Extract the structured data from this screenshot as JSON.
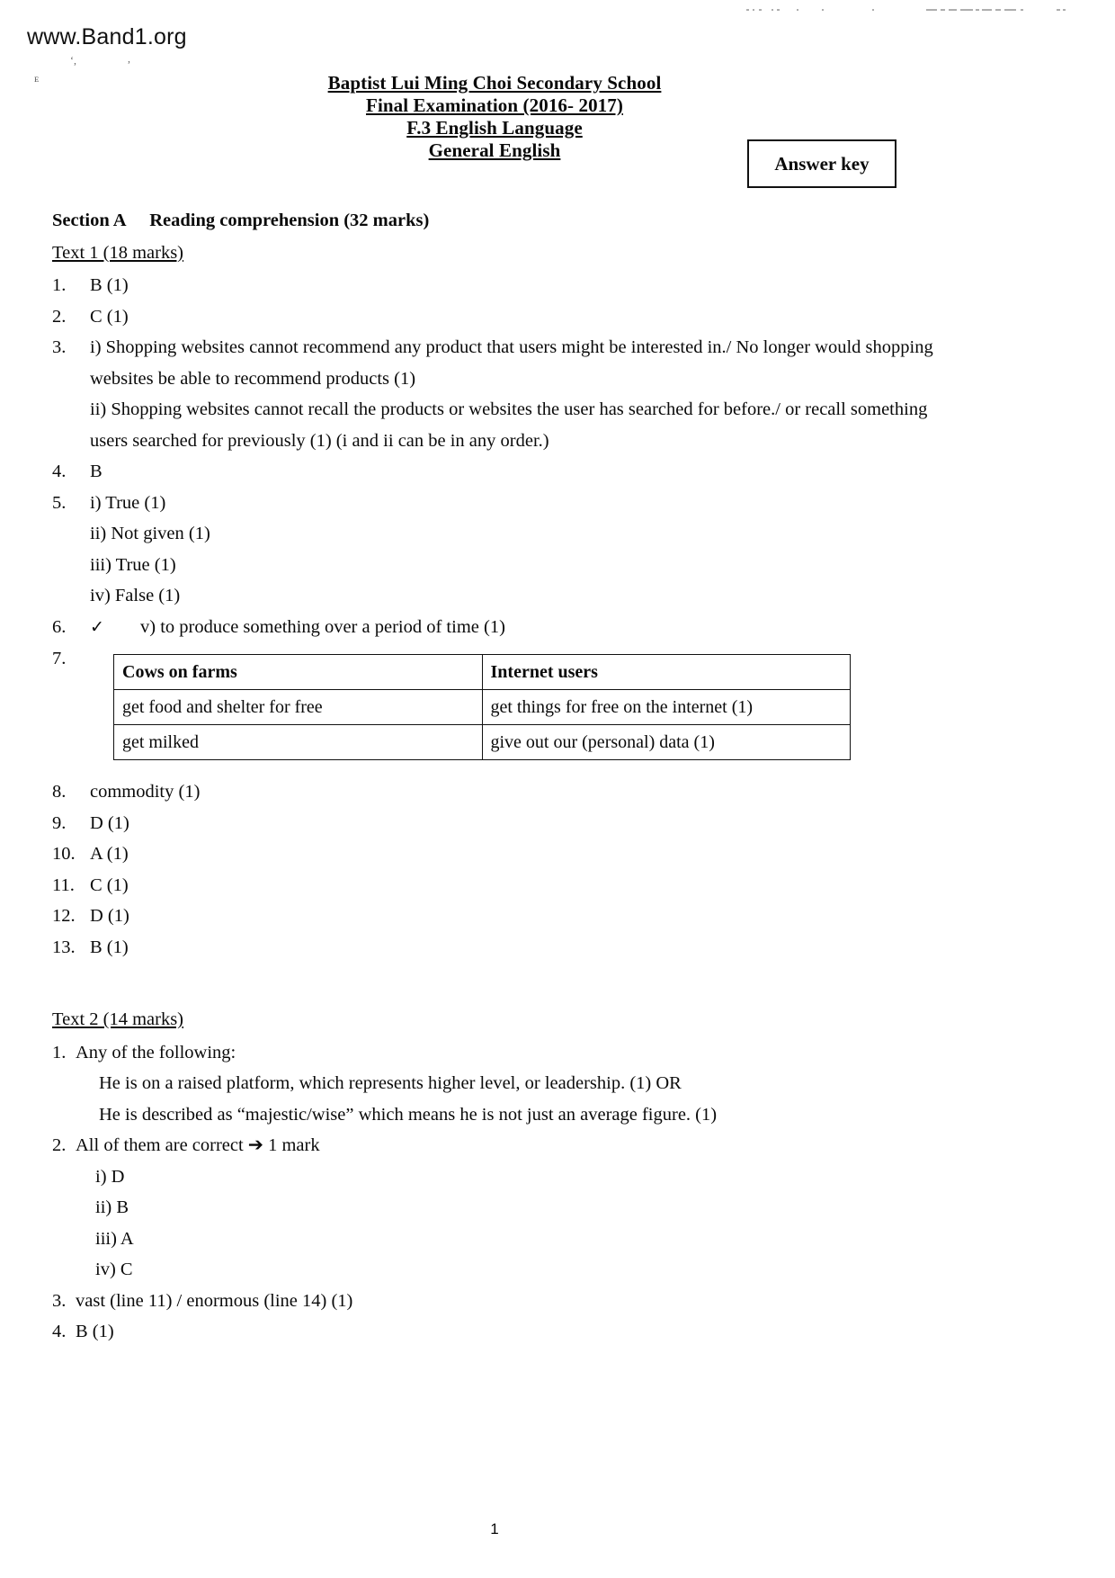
{
  "watermark": "www.Band1.org",
  "header": {
    "line1": "Baptist Lui Ming Choi Secondary School",
    "line2": "Final Examination (2016- 2017)",
    "line3": "F.3 English Language",
    "line4": "General English",
    "answer_key_label": "Answer key"
  },
  "section_a": {
    "heading": "Section A  Reading comprehension (32 marks)",
    "text1_heading": "Text 1 (18 marks)",
    "items": [
      {
        "num": "1.",
        "text": "B (1)"
      },
      {
        "num": "2.",
        "text": "C (1)"
      },
      {
        "num": "3.",
        "lines": [
          "i) Shopping websites cannot recommend any product that users might be interested in./ No longer would shopping websites be able to recommend products (1)",
          "ii) Shopping websites cannot recall the products or websites the user has searched for before./ or recall something users searched for previously (1) (i and ii can be in any order.)"
        ]
      },
      {
        "num": "4.",
        "text": "B"
      },
      {
        "num": "5.",
        "lines": [
          "i) True (1)",
          "ii) Not given (1)",
          "iii) True (1)",
          "iv) False (1)"
        ]
      },
      {
        "num": "6.",
        "check": "✓",
        "text": "v) to produce something over a period of time (1)"
      },
      {
        "num": "7.",
        "text": ""
      },
      {
        "num": "8.",
        "text": "commodity (1)"
      },
      {
        "num": "9.",
        "text": "D (1)"
      },
      {
        "num": "10.",
        "text": "A (1)"
      },
      {
        "num": "11.",
        "text": "C (1)"
      },
      {
        "num": "12.",
        "text": "D (1)"
      },
      {
        "num": "13.",
        "text": "B (1)"
      }
    ],
    "table": {
      "headers": [
        "Cows on farms",
        "Internet users"
      ],
      "rows": [
        [
          "get food and shelter for free",
          "get things for free on the internet (1)"
        ],
        [
          "get milked",
          "give out our (personal) data (1)"
        ]
      ]
    }
  },
  "text2": {
    "heading": "Text 2 (14 marks)",
    "item1_num": "1.",
    "item1_intro": "Any of the following:",
    "item1_optionA": "He is on a raised platform, which represents higher level, or leadership. (1) OR",
    "item1_optionB": "He is described as “majestic/wise” which means he is not just an average figure. (1)",
    "item2_num": "2.",
    "item2_text": "All of them are correct ➔ 1 mark",
    "item2_subs": [
      "i) D",
      "ii) B",
      "iii) A",
      "iv) C"
    ],
    "item3_num": "3.",
    "item3_text": "vast (line 11) / enormous (line 14) (1)",
    "item4_num": "4.",
    "item4_text": "B (1)"
  },
  "footer": {
    "page_number": "1"
  }
}
